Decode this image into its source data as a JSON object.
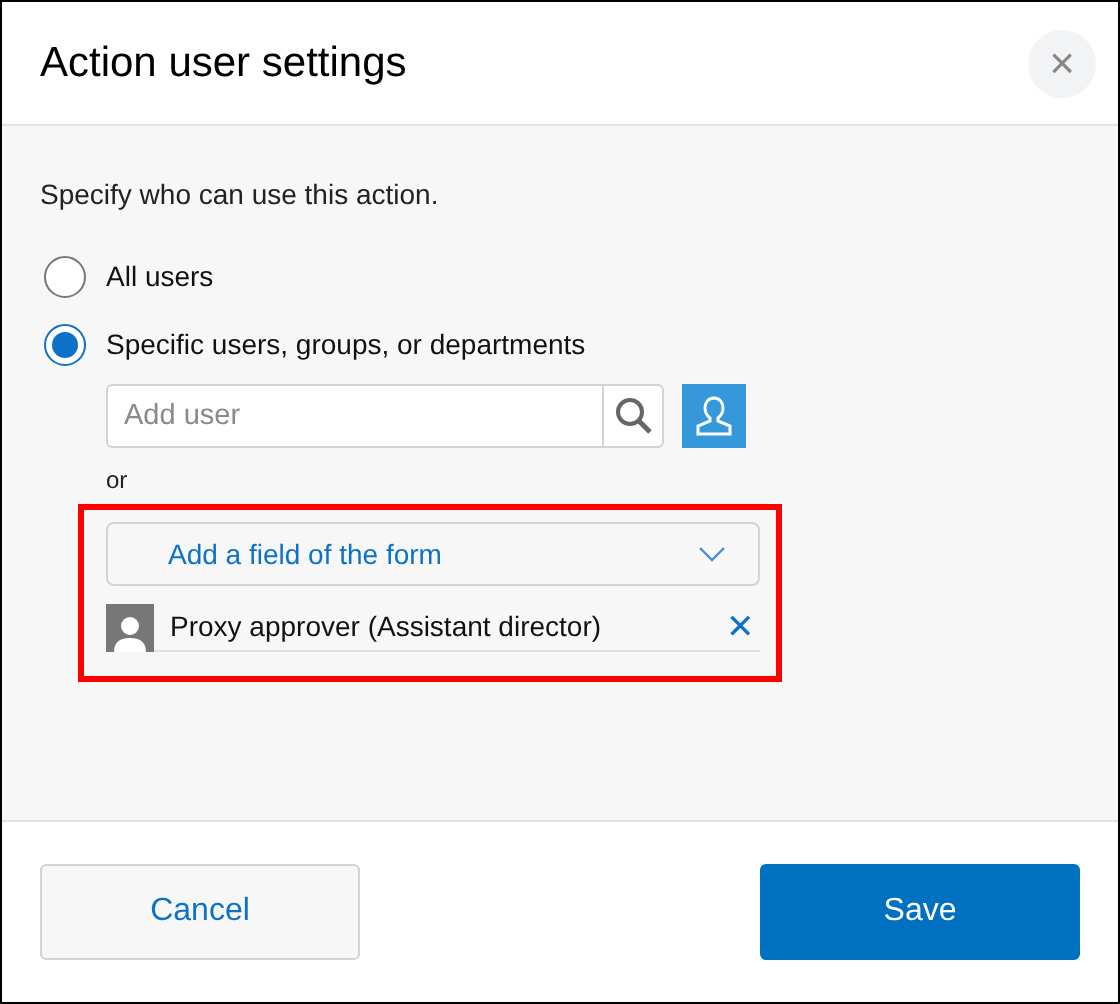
{
  "dialog": {
    "title": "Action user settings",
    "close": "×"
  },
  "instruction": "Specify who can use this action.",
  "options": [
    {
      "label": "All users",
      "selected": false
    },
    {
      "label": "Specific users, groups, or departments",
      "selected": true
    }
  ],
  "user_search": {
    "placeholder": "Add user"
  },
  "separator": "or",
  "form_field_select": {
    "label": "Add a field of the form"
  },
  "entries": [
    {
      "name": "Proxy approver (Assistant director)",
      "remove": "✕"
    }
  ],
  "buttons": {
    "cancel": "Cancel",
    "save": "Save"
  }
}
